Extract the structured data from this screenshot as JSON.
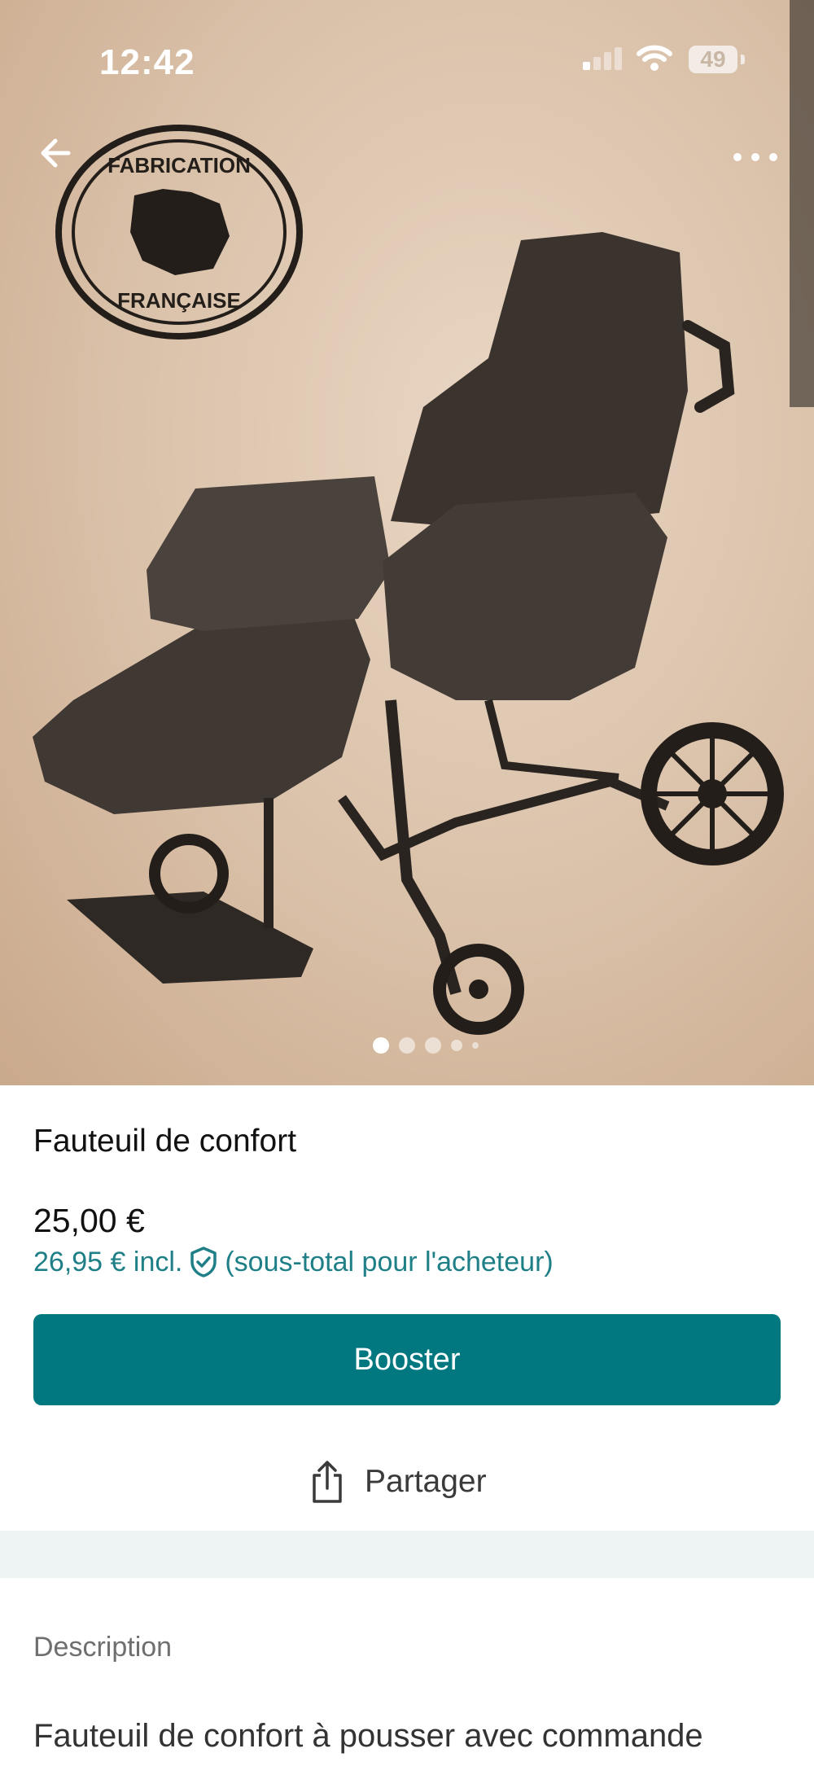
{
  "status_bar": {
    "time": "12:42",
    "battery": "49"
  },
  "hero": {
    "stamp_top": "FABRICATION",
    "stamp_bottom": "FRANÇAISE",
    "pager": {
      "count": 5,
      "active_index": 0
    }
  },
  "product": {
    "title": "Fauteuil de confort",
    "price": "25,00 €",
    "price_incl": "26,95 € incl.",
    "buyer_note": "(sous-total pour l'acheteur)"
  },
  "actions": {
    "boost_label": "Booster",
    "share_label": "Partager"
  },
  "description": {
    "label": "Description",
    "text": "Fauteuil de confort à pousser avec commande"
  },
  "colors": {
    "accent": "#017780",
    "link": "#1f7f87"
  }
}
